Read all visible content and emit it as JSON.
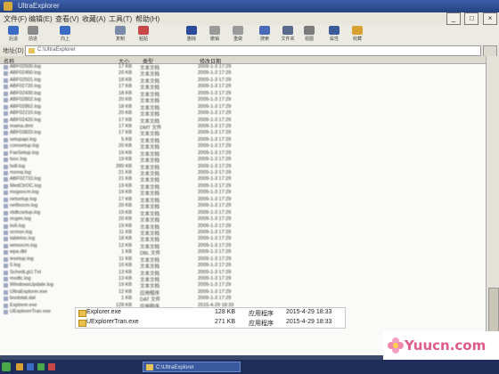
{
  "window": {
    "title": "UltraExplorer"
  },
  "menu": [
    "文件(F)",
    "编辑(E)",
    "查看(V)",
    "收藏(A)",
    "工具(T)",
    "帮助(H)"
  ],
  "window_buttons": [
    "_",
    "□",
    "×"
  ],
  "toolbar": [
    {
      "label": "后退",
      "icon": "back-arrow-icon",
      "color": "#3b6bc4"
    },
    {
      "label": "前进",
      "icon": "forward-arrow-icon",
      "color": "#8a8a8a"
    },
    {
      "label": "向上",
      "icon": "up-arrow-icon",
      "color": "#3b6bc4"
    },
    {
      "label": "复制",
      "icon": "copy-icon",
      "color": "#7a8aa8"
    },
    {
      "label": "粘贴",
      "icon": "paste-icon",
      "color": "#c84848"
    },
    {
      "label": "删除",
      "icon": "delete-icon",
      "color": "#2a4a9a"
    },
    {
      "label": "撤销",
      "icon": "undo-icon",
      "color": "#9a9a9a"
    },
    {
      "label": "重做",
      "icon": "redo-icon",
      "color": "#9a9a9a"
    },
    {
      "label": "搜索",
      "icon": "search-icon",
      "color": "#4a6ab8"
    },
    {
      "label": "文件夹",
      "icon": "folder-icon",
      "color": "#5a6a8a"
    },
    {
      "label": "视图",
      "icon": "view-icon",
      "color": "#7a7a7a"
    },
    {
      "label": "属性",
      "icon": "properties-icon",
      "color": "#3a5a9a"
    },
    {
      "label": "收藏",
      "icon": "favorites-icon",
      "color": "#d8a030"
    }
  ],
  "address": {
    "label": "地址(D)",
    "value": "C:\\UltraExplorer"
  },
  "columns": [
    "名称",
    "大小",
    "类型",
    "修改日期"
  ],
  "files": [
    {
      "name": "ABF02500.log",
      "size": "17 KB",
      "type": "文本文档",
      "date": "2009-1-3 17:29"
    },
    {
      "name": "ABF02450.log",
      "size": "20 KB",
      "type": "文本文档",
      "date": "2009-1-3 17:29"
    },
    {
      "name": "ABF02501.log",
      "size": "18 KB",
      "type": "文本文档",
      "date": "2009-1-3 17:29"
    },
    {
      "name": "ABF02720.log",
      "size": "17 KB",
      "type": "文本文档",
      "date": "2009-1-3 17:29"
    },
    {
      "name": "ABF02430.log",
      "size": "18 KB",
      "type": "文本文档",
      "date": "2009-1-3 17:29"
    },
    {
      "name": "ABF02802.log",
      "size": "20 KB",
      "type": "文本文档",
      "date": "2009-1-3 17:29"
    },
    {
      "name": "ABF02862.log",
      "size": "18 KB",
      "type": "文本文档",
      "date": "2009-1-3 17:29"
    },
    {
      "name": "ABF02210.log",
      "size": "20 KB",
      "type": "文本文档",
      "date": "2009-1-3 17:29"
    },
    {
      "name": "ABF02420.log",
      "size": "17 KB",
      "type": "文本文档",
      "date": "2009-1-3 17:29"
    },
    {
      "name": "mama.dmt",
      "size": "17 KB",
      "type": "DMT 文件",
      "date": "2009-1-3 17:29"
    },
    {
      "name": "ABF03820.log",
      "size": "17 KB",
      "type": "文本文档",
      "date": "2009-1-3 17:29"
    },
    {
      "name": "setupapi.log",
      "size": "5 KB",
      "type": "文本文档",
      "date": "2009-1-3 17:29"
    },
    {
      "name": "comsetup.log",
      "size": "20 KB",
      "type": "文本文档",
      "date": "2009-1-3 17:29"
    },
    {
      "name": "FaxSetup.log",
      "size": "19 KB",
      "type": "文本文档",
      "date": "2009-1-3 17:29"
    },
    {
      "name": "tsoc.log",
      "size": "19 KB",
      "type": "文本文档",
      "date": "2009-1-3 17:29"
    },
    {
      "name": "lsdl.log",
      "size": "280 KB",
      "type": "文本文档",
      "date": "2009-1-3 17:29"
    },
    {
      "name": "msmq.log",
      "size": "21 KB",
      "type": "文本文档",
      "date": "2009-1-3 17:29"
    },
    {
      "name": "ABF02710.log",
      "size": "21 KB",
      "type": "文本文档",
      "date": "2009-1-3 17:29"
    },
    {
      "name": "MedCtrOC.log",
      "size": "19 KB",
      "type": "文本文档",
      "date": "2009-1-3 17:29"
    },
    {
      "name": "msgsocm.log",
      "size": "19 KB",
      "type": "文本文档",
      "date": "2009-1-3 17:29"
    },
    {
      "name": "netsetup.log",
      "size": "17 KB",
      "type": "文本文档",
      "date": "2009-1-3 17:29"
    },
    {
      "name": "netfxocm.log",
      "size": "20 KB",
      "type": "文本文档",
      "date": "2009-1-3 17:29"
    },
    {
      "name": "ntdtcsetup.log",
      "size": "19 KB",
      "type": "文本文档",
      "date": "2009-1-3 17:29"
    },
    {
      "name": "ocgen.log",
      "size": "20 KB",
      "type": "文本文档",
      "date": "2009-1-3 17:29"
    },
    {
      "name": "iis6.log",
      "size": "19 KB",
      "type": "文本文档",
      "date": "2009-1-3 17:29"
    },
    {
      "name": "ocmsn.log",
      "size": "11 KB",
      "type": "文本文档",
      "date": "2009-1-3 17:29"
    },
    {
      "name": "tabletoc.log",
      "size": "18 KB",
      "type": "文本文档",
      "date": "2009-1-3 17:29"
    },
    {
      "name": "wmsocm.log",
      "size": "12 KB",
      "type": "文本文档",
      "date": "2009-1-3 17:29"
    },
    {
      "name": "wpa.dbl",
      "size": "1 KB",
      "type": "DBL 文件",
      "date": "2009-1-3 17:29"
    },
    {
      "name": "iesetup.log",
      "size": "11 KB",
      "type": "文本文档",
      "date": "2009-1-3 17:29"
    },
    {
      "name": "0.log",
      "size": "10 KB",
      "type": "文本文档",
      "date": "2009-1-3 17:29"
    },
    {
      "name": "SchedLgU.Txt",
      "size": "13 KB",
      "type": "文本文档",
      "date": "2009-1-3 17:29"
    },
    {
      "name": "msdtc.log",
      "size": "13 KB",
      "type": "文本文档",
      "date": "2009-1-3 17:29"
    },
    {
      "name": "WindowsUpdate.log",
      "size": "19 KB",
      "type": "文本文档",
      "date": "2009-1-3 17:29"
    },
    {
      "name": "UltraExplorer.exe",
      "size": "12 KB",
      "type": "应用程序",
      "date": "2009-1-3 17:29"
    },
    {
      "name": "bootstat.dat",
      "size": "1 KB",
      "type": "DAT 文件",
      "date": "2009-1-3 17:29"
    }
  ],
  "bottom_rows": [
    {
      "name": "Explorer.exe",
      "size": "128 KB",
      "type": "应用程序",
      "date": "2015-4-29 18:33"
    },
    {
      "name": "UExplorerTran.exe",
      "size": "271 KB",
      "type": "应用程序",
      "date": "2015-4-29 18:33"
    }
  ],
  "popup_rows": [
    {
      "name": "Explorer.exe",
      "size": "128 KB",
      "type": "应用程序",
      "date": "2015-4-29 18:33"
    },
    {
      "name": "UExplorerTran.exe",
      "size": "271 KB",
      "type": "应用程序",
      "date": "2015-4-29 18:33"
    }
  ],
  "taskbar": {
    "task_label": "C:\\UltraExplorer"
  },
  "watermark": {
    "text": "Yuucn.com"
  }
}
